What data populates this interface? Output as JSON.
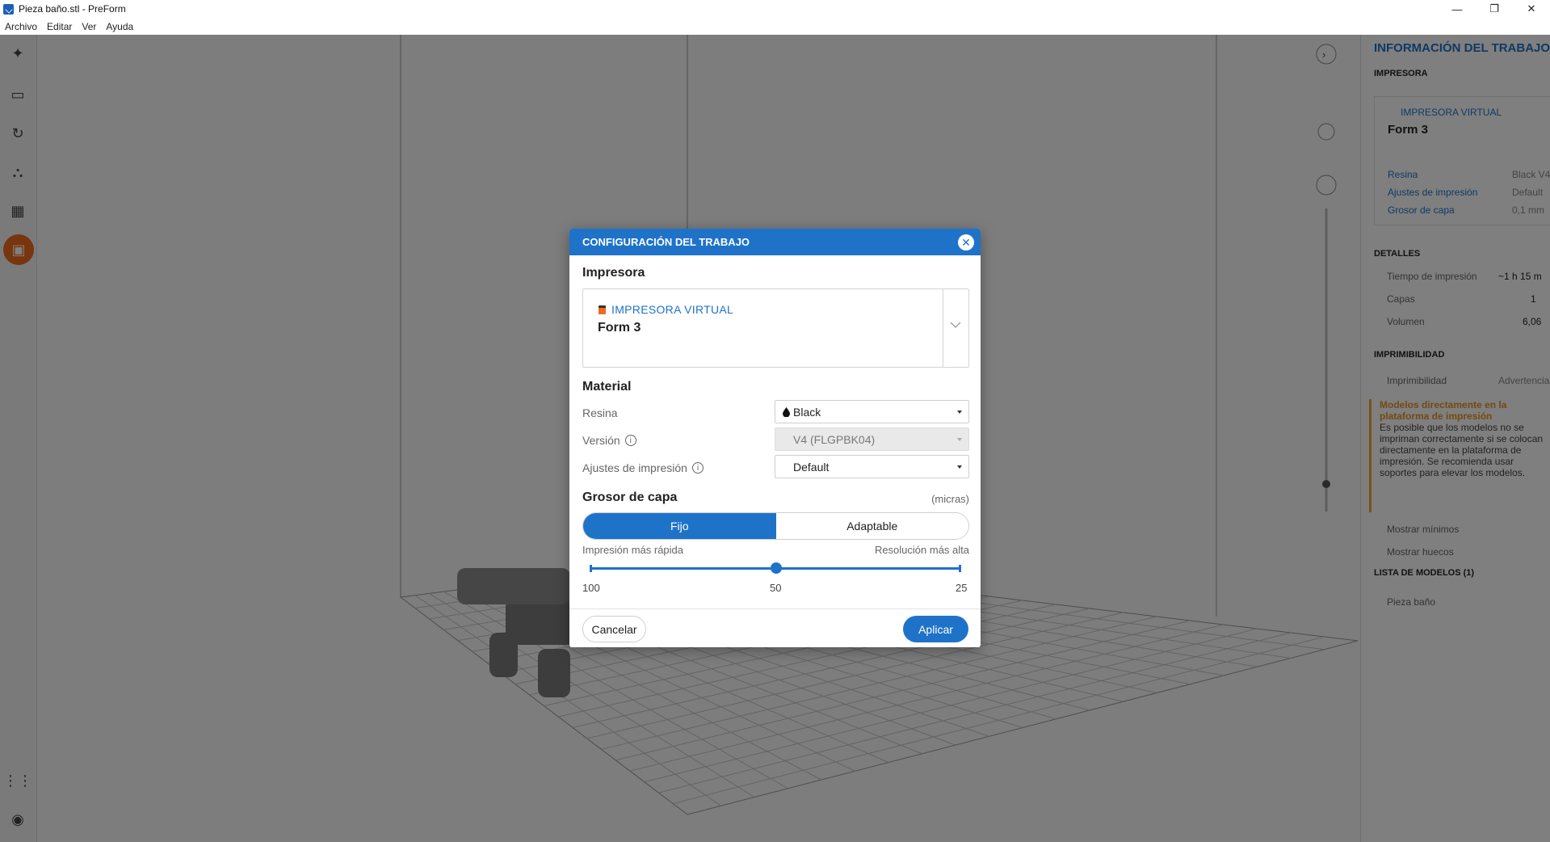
{
  "window": {
    "title": "Pieza baño.stl - PreForm",
    "controls": {
      "minimize": "—",
      "maximize": "❐",
      "close": "✕"
    }
  },
  "menu": [
    "Archivo",
    "Editar",
    "Ver",
    "Ayuda"
  ],
  "left_toolbar": {
    "tools": [
      "magic-wand-icon",
      "scale-icon",
      "rotate-icon",
      "supports-icon",
      "layout-icon",
      "printer-icon"
    ],
    "bottom": [
      "apps-icon",
      "account-icon"
    ]
  },
  "right_panel": {
    "title": "INFORMACIÓN DEL TRABAJO",
    "printer_heading": "IMPRESORA",
    "printer_type": "IMPRESORA VIRTUAL",
    "printer_name": "Form 3",
    "rows": [
      {
        "label": "Resina",
        "value": "Black V4"
      },
      {
        "label": "Ajustes de impresión",
        "value": "Default"
      },
      {
        "label": "Grosor de capa",
        "value": "0,1 mm"
      }
    ],
    "details_heading": "DETALLES",
    "details": [
      {
        "label": "Tiempo de impresión",
        "value": "~1 h 15 m"
      },
      {
        "label": "Capas",
        "value": "1"
      },
      {
        "label": "Volumen",
        "value": "6,06"
      }
    ],
    "printability_heading": "IMPRIMIBILIDAD",
    "printability_row": {
      "label": "Imprimibilidad",
      "value": "Advertencia"
    },
    "warning_title": "Modelos directamente en la plataforma de impresión",
    "warning_body": "Es posible que los modelos no se impriman correctamente si se colocan directamente en la plataforma de impresión. Se recomienda usar soportes para elevar los modelos.",
    "checks": [
      "Mostrar mínimos",
      "Mostrar huecos"
    ],
    "models_heading": "LISTA DE MODELOS (1)",
    "models": [
      "Pieza baño"
    ]
  },
  "dialog": {
    "title": "CONFIGURACIÓN DEL TRABAJO",
    "close_label": "✕",
    "printer_section": "Impresora",
    "printer_type": "IMPRESORA VIRTUAL",
    "printer_name": "Form 3",
    "material_section": "Material",
    "resin_label": "Resina",
    "resin_value": "Black",
    "version_label": "Versión",
    "version_value": "V4 (FLGPBK04)",
    "settings_label": "Ajustes de impresión",
    "settings_value": "Default",
    "layer_section": "Grosor de capa",
    "layer_units": "(micras)",
    "mode_fixed": "Fijo",
    "mode_adaptive": "Adaptable",
    "faster_label": "Impresión más rápida",
    "higher_res_label": "Resolución más alta",
    "ticks": [
      "100",
      "50",
      "25"
    ],
    "selected_layer": "50",
    "cancel_label": "Cancelar",
    "apply_label": "Aplicar"
  },
  "colors": {
    "accent": "#1e73c9",
    "active_tool": "#f06a1c",
    "warning": "#f0a630"
  }
}
